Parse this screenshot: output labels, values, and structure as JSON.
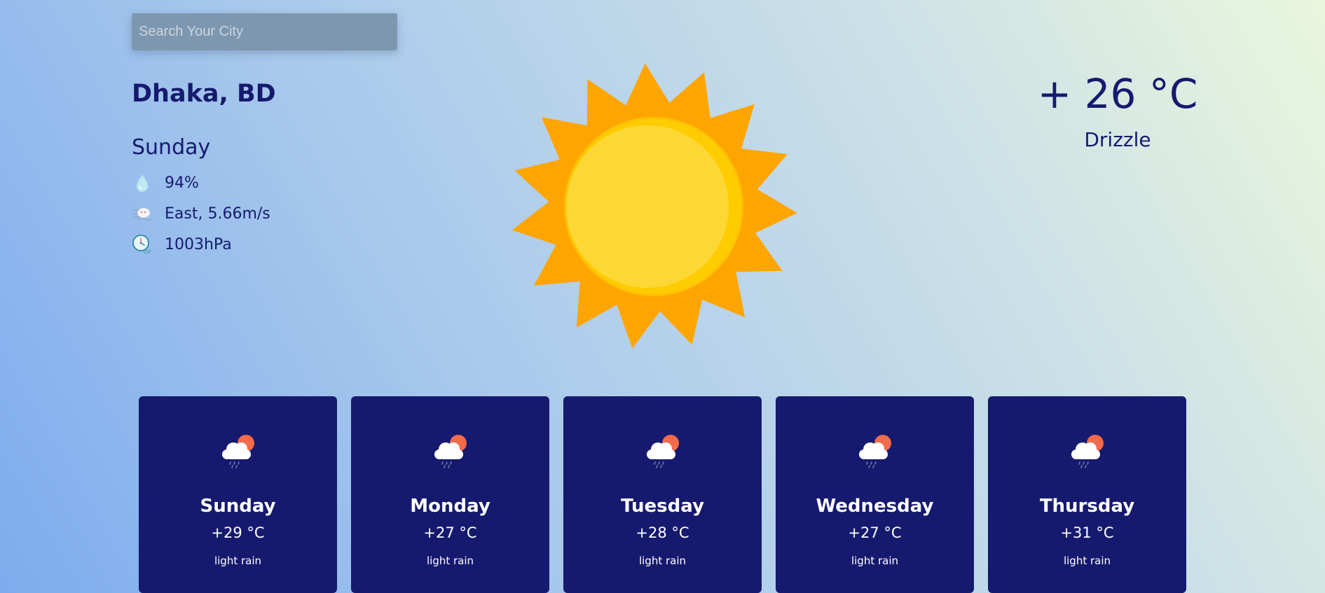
{
  "search": {
    "placeholder": "Search Your City",
    "value": ""
  },
  "current": {
    "location": "Dhaka, BD",
    "day": "Sunday",
    "humidity": "94%",
    "wind": "East, 5.66m/s",
    "pressure": "1003hPa",
    "temperature": "+ 26 °C",
    "condition": "Drizzle",
    "main_icon": "sun-icon"
  },
  "forecast": [
    {
      "day": "Sunday",
      "temp": "+29 °C",
      "desc": "light rain",
      "icon": "cloud-rain-sun-icon"
    },
    {
      "day": "Monday",
      "temp": "+27 °C",
      "desc": "light rain",
      "icon": "cloud-rain-sun-icon"
    },
    {
      "day": "Tuesday",
      "temp": "+28 °C",
      "desc": "light rain",
      "icon": "cloud-rain-sun-icon"
    },
    {
      "day": "Wednesday",
      "temp": "+27 °C",
      "desc": "light rain",
      "icon": "cloud-rain-sun-icon"
    },
    {
      "day": "Thursday",
      "temp": "+31 °C",
      "desc": "light rain",
      "icon": "cloud-rain-sun-icon"
    }
  ],
  "colors": {
    "text_primary": "#161a6e",
    "card_bg": "#161a6e",
    "sun_outer": "#ffa500",
    "sun_inner": "#fdd835",
    "search_bg": "#7d97b0"
  }
}
